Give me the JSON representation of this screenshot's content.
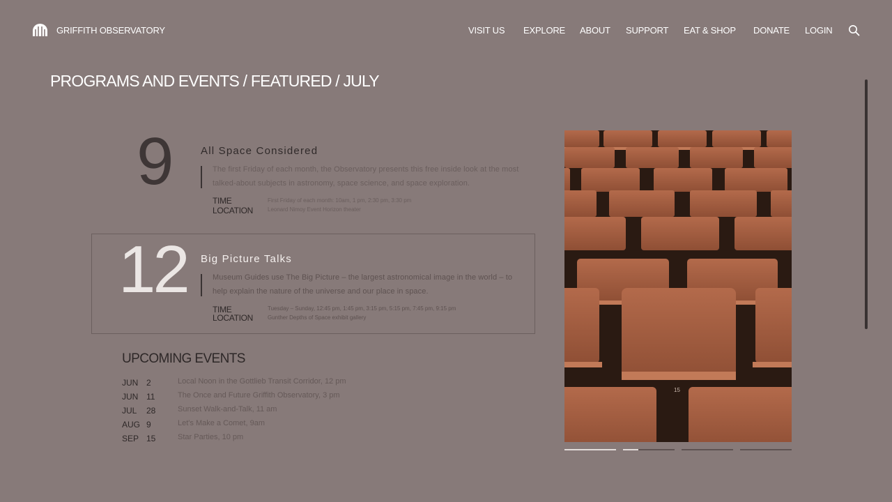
{
  "header": {
    "brand": "GRIFFITH OBSERVATORY",
    "nav": [
      "VISIT US",
      "EXPLORE",
      "ABOUT",
      "SUPPORT",
      "EAT & SHOP",
      "DONATE",
      "LOGIN"
    ]
  },
  "breadcrumb": "PROGRAMS AND EVENTS / FEATURED / JULY",
  "featured": [
    {
      "day": "9",
      "title": "All Space Considered",
      "description": "The first Friday of each month, the Observatory presents this free inside look at the most talked-about subjects in astronomy, space science, and space exploration.",
      "time_label": "TIME",
      "location_label": "LOCATION",
      "time": "First Friday of each month: 10am, 1 pm, 2:30 pm, 3:30 pm",
      "location": "Leonard Nimoy Event Horizon theater"
    },
    {
      "day": "12",
      "title": "Big Picture Talks",
      "description": "Museum Guides use The Big Picture – the largest astronomical image in the world – to help explain the nature of the universe and our place in space.",
      "time_label": "TIME",
      "location_label": "LOCATION",
      "time": "Tuesday – Sunday, 12:45 pm, 1:45 pm, 3:15 pm, 5:15 pm, 7:45 pm, 9:15 pm",
      "location": "Gunther Depths of Space exhibit gallery"
    }
  ],
  "upcoming": {
    "title": "UPCOMING EVENTS",
    "events": [
      {
        "month": "JUN",
        "day": "2",
        "text": "Local Noon in the Gottlieb Transit Corridor, 12 pm"
      },
      {
        "month": "JUN",
        "day": "11",
        "text": "The Once and Future Griffith Observatory, 3 pm"
      },
      {
        "month": "JUL",
        "day": "28",
        "text": "Sunset Walk-and-Talk, 11 am"
      },
      {
        "month": "AUG",
        "day": "9",
        "text": "Let's Make a Comet, 9am"
      },
      {
        "month": "SEP",
        "day": "15",
        "text": "Star Parties, 10 pm"
      }
    ]
  },
  "photo": {
    "seat_number": "15"
  },
  "carousel": {
    "slides": 4,
    "active": 1,
    "progress": 0.3
  },
  "colors": {
    "background": "#877a79",
    "text_light": "#ffffff",
    "text_dark": "#2e2828",
    "seat": "#a86043"
  },
  "icons": {
    "logo": "observatory-dome-icon",
    "search": "search-icon"
  }
}
